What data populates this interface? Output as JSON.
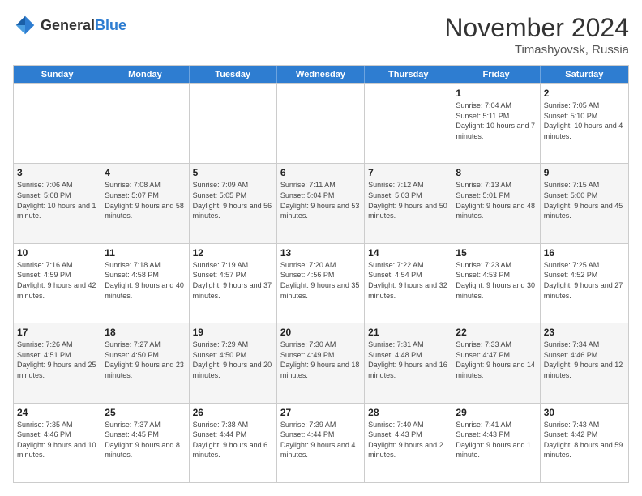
{
  "header": {
    "logo_general": "General",
    "logo_blue": "Blue",
    "title": "November 2024",
    "location": "Timashyovsk, Russia"
  },
  "days_of_week": [
    "Sunday",
    "Monday",
    "Tuesday",
    "Wednesday",
    "Thursday",
    "Friday",
    "Saturday"
  ],
  "rows": [
    [
      {
        "day": "",
        "info": ""
      },
      {
        "day": "",
        "info": ""
      },
      {
        "day": "",
        "info": ""
      },
      {
        "day": "",
        "info": ""
      },
      {
        "day": "",
        "info": ""
      },
      {
        "day": "1",
        "info": "Sunrise: 7:04 AM\nSunset: 5:11 PM\nDaylight: 10 hours and 7 minutes."
      },
      {
        "day": "2",
        "info": "Sunrise: 7:05 AM\nSunset: 5:10 PM\nDaylight: 10 hours and 4 minutes."
      }
    ],
    [
      {
        "day": "3",
        "info": "Sunrise: 7:06 AM\nSunset: 5:08 PM\nDaylight: 10 hours and 1 minute."
      },
      {
        "day": "4",
        "info": "Sunrise: 7:08 AM\nSunset: 5:07 PM\nDaylight: 9 hours and 58 minutes."
      },
      {
        "day": "5",
        "info": "Sunrise: 7:09 AM\nSunset: 5:05 PM\nDaylight: 9 hours and 56 minutes."
      },
      {
        "day": "6",
        "info": "Sunrise: 7:11 AM\nSunset: 5:04 PM\nDaylight: 9 hours and 53 minutes."
      },
      {
        "day": "7",
        "info": "Sunrise: 7:12 AM\nSunset: 5:03 PM\nDaylight: 9 hours and 50 minutes."
      },
      {
        "day": "8",
        "info": "Sunrise: 7:13 AM\nSunset: 5:01 PM\nDaylight: 9 hours and 48 minutes."
      },
      {
        "day": "9",
        "info": "Sunrise: 7:15 AM\nSunset: 5:00 PM\nDaylight: 9 hours and 45 minutes."
      }
    ],
    [
      {
        "day": "10",
        "info": "Sunrise: 7:16 AM\nSunset: 4:59 PM\nDaylight: 9 hours and 42 minutes."
      },
      {
        "day": "11",
        "info": "Sunrise: 7:18 AM\nSunset: 4:58 PM\nDaylight: 9 hours and 40 minutes."
      },
      {
        "day": "12",
        "info": "Sunrise: 7:19 AM\nSunset: 4:57 PM\nDaylight: 9 hours and 37 minutes."
      },
      {
        "day": "13",
        "info": "Sunrise: 7:20 AM\nSunset: 4:56 PM\nDaylight: 9 hours and 35 minutes."
      },
      {
        "day": "14",
        "info": "Sunrise: 7:22 AM\nSunset: 4:54 PM\nDaylight: 9 hours and 32 minutes."
      },
      {
        "day": "15",
        "info": "Sunrise: 7:23 AM\nSunset: 4:53 PM\nDaylight: 9 hours and 30 minutes."
      },
      {
        "day": "16",
        "info": "Sunrise: 7:25 AM\nSunset: 4:52 PM\nDaylight: 9 hours and 27 minutes."
      }
    ],
    [
      {
        "day": "17",
        "info": "Sunrise: 7:26 AM\nSunset: 4:51 PM\nDaylight: 9 hours and 25 minutes."
      },
      {
        "day": "18",
        "info": "Sunrise: 7:27 AM\nSunset: 4:50 PM\nDaylight: 9 hours and 23 minutes."
      },
      {
        "day": "19",
        "info": "Sunrise: 7:29 AM\nSunset: 4:50 PM\nDaylight: 9 hours and 20 minutes."
      },
      {
        "day": "20",
        "info": "Sunrise: 7:30 AM\nSunset: 4:49 PM\nDaylight: 9 hours and 18 minutes."
      },
      {
        "day": "21",
        "info": "Sunrise: 7:31 AM\nSunset: 4:48 PM\nDaylight: 9 hours and 16 minutes."
      },
      {
        "day": "22",
        "info": "Sunrise: 7:33 AM\nSunset: 4:47 PM\nDaylight: 9 hours and 14 minutes."
      },
      {
        "day": "23",
        "info": "Sunrise: 7:34 AM\nSunset: 4:46 PM\nDaylight: 9 hours and 12 minutes."
      }
    ],
    [
      {
        "day": "24",
        "info": "Sunrise: 7:35 AM\nSunset: 4:46 PM\nDaylight: 9 hours and 10 minutes."
      },
      {
        "day": "25",
        "info": "Sunrise: 7:37 AM\nSunset: 4:45 PM\nDaylight: 9 hours and 8 minutes."
      },
      {
        "day": "26",
        "info": "Sunrise: 7:38 AM\nSunset: 4:44 PM\nDaylight: 9 hours and 6 minutes."
      },
      {
        "day": "27",
        "info": "Sunrise: 7:39 AM\nSunset: 4:44 PM\nDaylight: 9 hours and 4 minutes."
      },
      {
        "day": "28",
        "info": "Sunrise: 7:40 AM\nSunset: 4:43 PM\nDaylight: 9 hours and 2 minutes."
      },
      {
        "day": "29",
        "info": "Sunrise: 7:41 AM\nSunset: 4:43 PM\nDaylight: 9 hours and 1 minute."
      },
      {
        "day": "30",
        "info": "Sunrise: 7:43 AM\nSunset: 4:42 PM\nDaylight: 8 hours and 59 minutes."
      }
    ]
  ]
}
